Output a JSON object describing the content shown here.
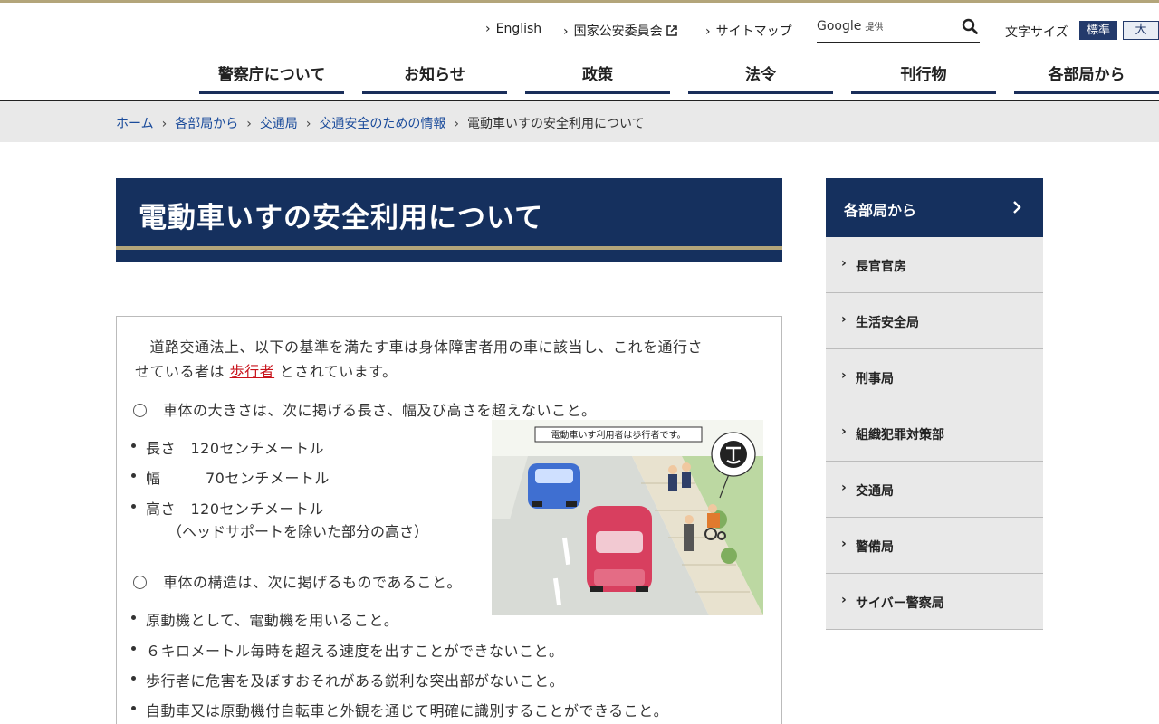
{
  "header": {
    "util_links": [
      {
        "label": "English"
      },
      {
        "label": "国家公安委員会"
      },
      {
        "label": "サイトマップ"
      }
    ],
    "search": {
      "brand": "Google",
      "brand_suffix": "提供"
    },
    "font_size": {
      "label": "文字サイズ",
      "standard": "標準",
      "large": "大"
    }
  },
  "nav": {
    "items": [
      "警察庁について",
      "お知らせ",
      "政策",
      "法令",
      "刊行物",
      "各部局から"
    ]
  },
  "breadcrumb": {
    "items": [
      "ホーム",
      "各部局から",
      "交通局",
      "交通安全のための情報"
    ],
    "current": "電動車いすの安全利用について"
  },
  "page": {
    "title": "電動車いすの安全利用について",
    "intro_line1": "　道路交通法上、以下の基準を満たす車は身体障害者用の車に該当し、これを通行さ",
    "intro_line2_pre": "せている者は ",
    "intro_link": "歩行者",
    "intro_line2_post": " とされています。",
    "size_heading": "車体の大きさは、次に掲げる長さ、幅及び高さを超えないこと。",
    "size_items": [
      "長さ　120センチメートル",
      "幅　　　70センチメートル",
      "高さ　120センチメートル"
    ],
    "size_note": "（ヘッドサポートを除いた部分の高さ）",
    "structure_heading": "車体の構造は、次に掲げるものであること。",
    "structure_items": [
      "原動機として、電動機を用いること。",
      "６キロメートル毎時を超える速度を出すことができないこと。",
      "歩行者に危害を及ぼすおそれがある鋭利な突出部がないこと。",
      "自動車又は原動機付自転車と外観を通じて明確に識別することができること。"
    ],
    "illustration_caption": "電動車いす利用者は歩行者です。"
  },
  "sidebar": {
    "heading": "各部局から",
    "items": [
      "長官官房",
      "生活安全局",
      "刑事局",
      "組織犯罪対策部",
      "交通局",
      "警備局",
      "サイバー警察局"
    ]
  },
  "colors": {
    "navy": "#15305e",
    "gold": "#b3a57a",
    "link": "#1a4b9b",
    "link_red": "#c8131b"
  }
}
